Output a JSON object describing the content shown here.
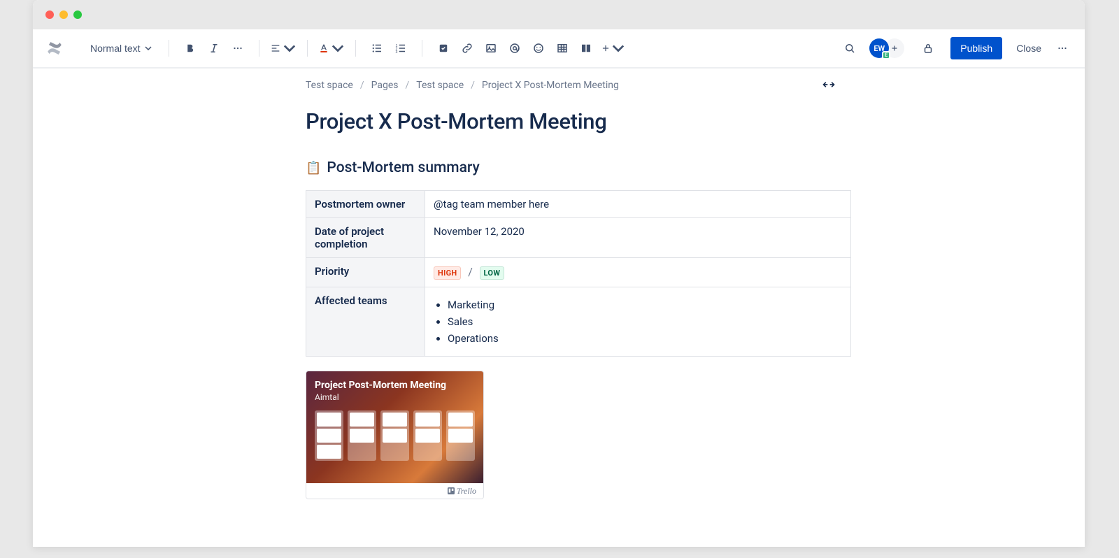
{
  "toolbar": {
    "text_style": "Normal text",
    "publish": "Publish",
    "close": "Close"
  },
  "breadcrumb": [
    "Test space",
    "Pages",
    "Test space",
    "Project X Post-Mortem Meeting"
  ],
  "page": {
    "title": "Project X Post-Mortem Meeting"
  },
  "section": {
    "icon": "📋",
    "heading": "Post-Mortem summary"
  },
  "meta_table": {
    "rows": [
      {
        "label": "Postmortem owner",
        "value": "@tag team member here"
      },
      {
        "label": "Date of project completion",
        "value": "November 12, 2020"
      },
      {
        "label": "Priority",
        "badges": [
          "HIGH",
          "LOW"
        ],
        "sep": "/"
      },
      {
        "label": "Affected teams",
        "list": [
          "Marketing",
          "Sales",
          "Operations"
        ]
      }
    ]
  },
  "trello": {
    "title": "Project Post-Mortem Meeting",
    "subtitle": "Aimtal",
    "brand": "Trello"
  },
  "avatar": {
    "initials": "EW"
  }
}
